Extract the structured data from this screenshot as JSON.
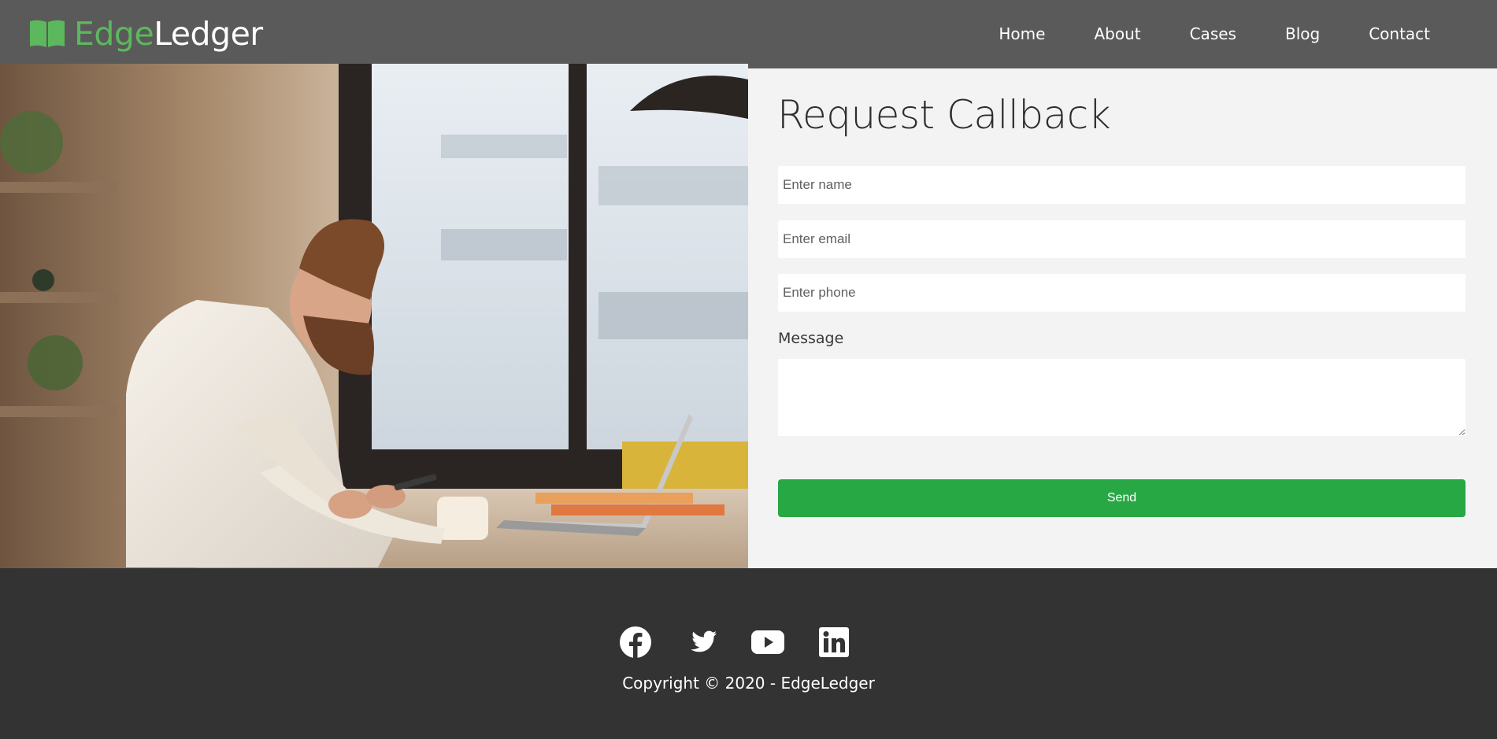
{
  "brand": {
    "name_accent": "Edge",
    "name_rest": "Ledger",
    "icon": "open-book-icon",
    "accent_color": "#5cb85c"
  },
  "nav": {
    "items": [
      {
        "label": "Home"
      },
      {
        "label": "About"
      },
      {
        "label": "Cases"
      },
      {
        "label": "Blog"
      },
      {
        "label": "Contact"
      }
    ]
  },
  "hero": {
    "photo": "man-using-phone-at-laptop-photo"
  },
  "form": {
    "title": "Request Callback",
    "name_placeholder": "Enter name",
    "email_placeholder": "Enter email",
    "phone_placeholder": "Enter phone",
    "message_label": "Message",
    "message_value": "",
    "send_label": "Send",
    "send_color": "#28a745"
  },
  "footer": {
    "socials": [
      "facebook-icon",
      "twitter-icon",
      "youtube-icon",
      "linkedin-icon"
    ],
    "copyright": "Copyright © 2020 - EdgeLedger",
    "background": "#333333"
  },
  "colors": {
    "header": "#5a5a5a",
    "panel": "#f3f3f3"
  }
}
